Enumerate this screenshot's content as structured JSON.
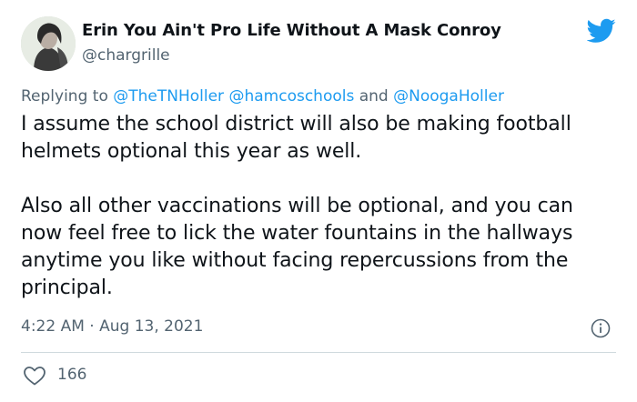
{
  "author": {
    "display_name": "Erin You Ain't Pro Life Without A Mask Conroy",
    "handle": "@chargrille"
  },
  "icons": {
    "platform": "twitter-bird-icon",
    "info": "info-icon",
    "like": "heart-icon"
  },
  "colors": {
    "brand": "#1d9bf0",
    "secondary_text": "#536471",
    "divider": "#cfd9de"
  },
  "reply": {
    "prefix": "Replying to",
    "mention_1": "@TheTNHoller",
    "mention_2": "@hamcoschools",
    "conjunction": "and",
    "mention_3": "@NoogaHoller"
  },
  "tweet": {
    "paragraph_1": "I assume the school district will also be making football helmets optional this year as well.",
    "paragraph_2": "Also all other vaccinations will be optional, and you can now feel free to lick the water fountains in the hallways anytime you like without facing repercussions from the principal."
  },
  "meta": {
    "time": "4:22 AM",
    "separator": "·",
    "date": "Aug 13, 2021"
  },
  "engagement": {
    "likes": "166"
  }
}
